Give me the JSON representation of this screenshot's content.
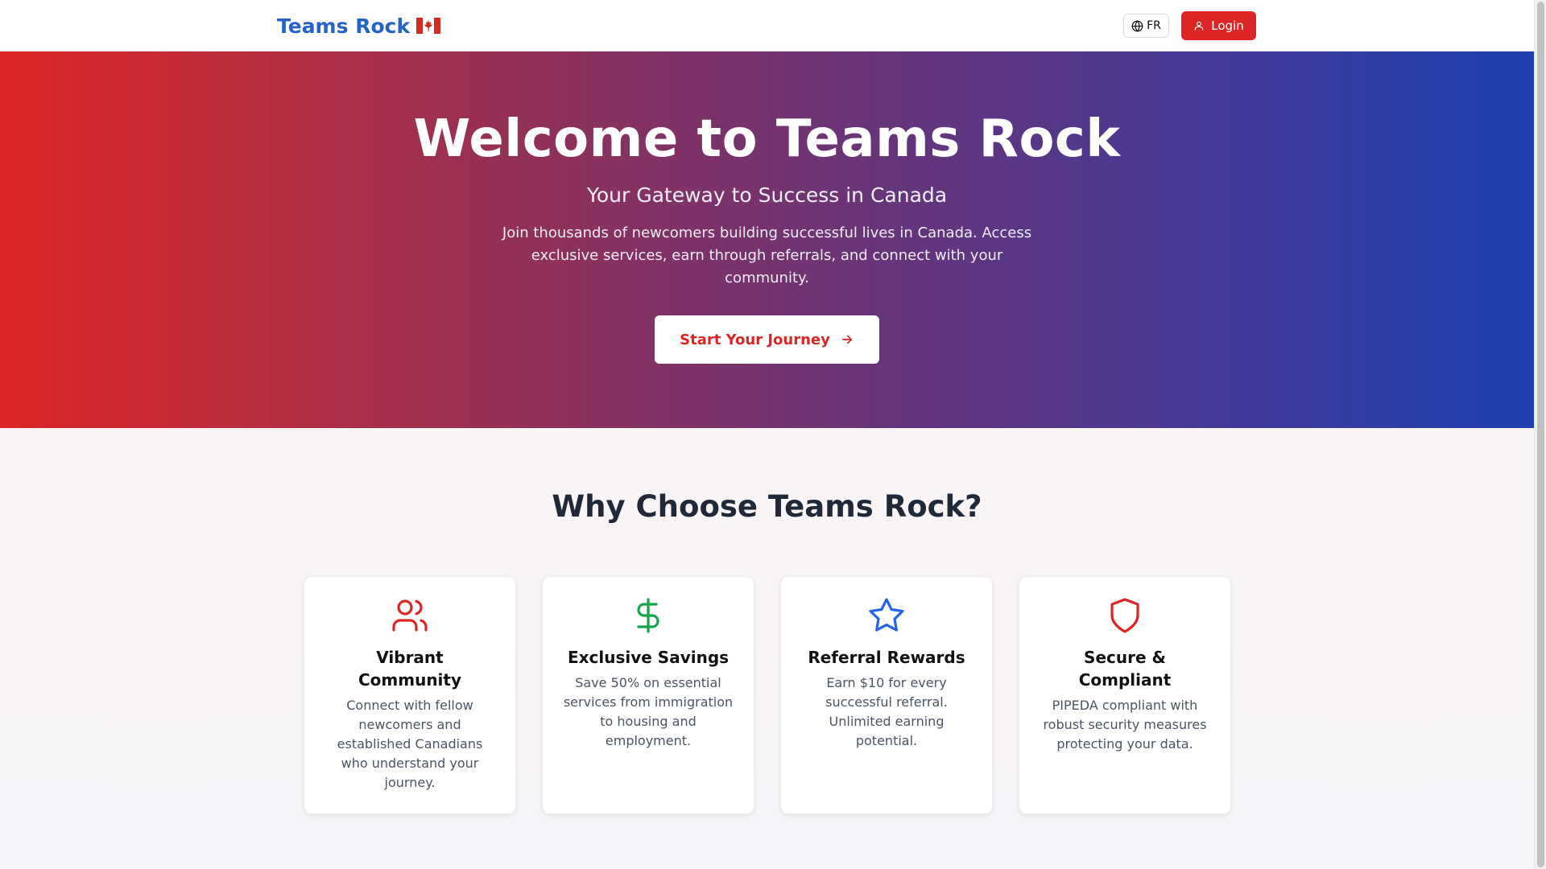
{
  "header": {
    "brand": "Teams Rock",
    "language_toggle": "FR",
    "login_label": "Login"
  },
  "hero": {
    "title": "Welcome to Teams Rock",
    "subtitle": "Your Gateway to Success in Canada",
    "description": "Join thousands of newcomers building successful lives in Canada. Access exclusive services, earn through referrals, and connect with your community.",
    "cta_label": "Start Your Journey"
  },
  "features": {
    "title": "Why Choose Teams Rock?",
    "cards": [
      {
        "icon": "users-icon",
        "title": "Vibrant Community",
        "description": "Connect with fellow newcomers and established Canadians who understand your journey."
      },
      {
        "icon": "dollar-icon",
        "title": "Exclusive Savings",
        "description": "Save 50% on essential services from immigration to housing and employment."
      },
      {
        "icon": "star-icon",
        "title": "Referral Rewards",
        "description": "Earn $10 for every successful referral. Unlimited earning potential."
      },
      {
        "icon": "shield-icon",
        "title": "Secure & Compliant",
        "description": "PIPEDA compliant with robust security measures protecting your data."
      }
    ]
  },
  "colors": {
    "brand_blue": "#2563c9",
    "accent_red": "#dc2626",
    "icon_green": "#16a34a"
  }
}
